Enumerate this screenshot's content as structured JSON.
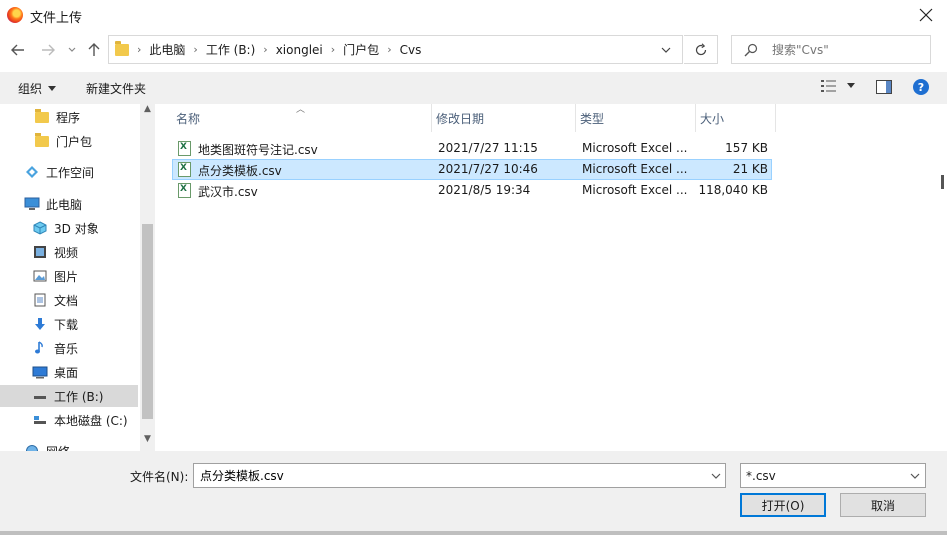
{
  "window": {
    "title": "文件上传"
  },
  "address": {
    "crumbs": [
      "此电脑",
      "工作 (B:)",
      "xionglei",
      "门户包",
      "Cvs"
    ]
  },
  "search": {
    "placeholder": "搜索\"Cvs\""
  },
  "toolbar": {
    "organize": "组织",
    "new_folder": "新建文件夹",
    "help": "?"
  },
  "nav": {
    "items": [
      {
        "label": "程序",
        "icon": "folder-icon"
      },
      {
        "label": "门户包",
        "icon": "folder-icon"
      },
      {
        "label": "工作空间",
        "icon": "workspace-icon"
      },
      {
        "label": "此电脑",
        "icon": "computer-icon"
      },
      {
        "label": "3D 对象",
        "icon": "3d-objects-icon"
      },
      {
        "label": "视频",
        "icon": "video-icon"
      },
      {
        "label": "图片",
        "icon": "pictures-icon"
      },
      {
        "label": "文档",
        "icon": "documents-icon"
      },
      {
        "label": "下载",
        "icon": "download-icon"
      },
      {
        "label": "音乐",
        "icon": "music-icon"
      },
      {
        "label": "桌面",
        "icon": "desktop-icon"
      },
      {
        "label": "工作 (B:)",
        "icon": "drive-icon"
      },
      {
        "label": "本地磁盘 (C:)",
        "icon": "drive-icon"
      },
      {
        "label": "网络",
        "icon": "network-icon"
      }
    ]
  },
  "columns": {
    "name": "名称",
    "modified": "修改日期",
    "type": "类型",
    "size": "大小"
  },
  "files": [
    {
      "name": "地类图斑符号注记.csv",
      "modified": "2021/7/27 11:15",
      "type": "Microsoft Excel ...",
      "size": "157 KB"
    },
    {
      "name": "点分类模板.csv",
      "modified": "2021/7/27 10:46",
      "type": "Microsoft Excel ...",
      "size": "21 KB"
    },
    {
      "name": "武汉市.csv",
      "modified": "2021/8/5 19:34",
      "type": "Microsoft Excel ...",
      "size": "118,040 KB"
    }
  ],
  "footer": {
    "filename_label": "文件名(N):",
    "filename_value": "点分类模板.csv",
    "filetype_value": "*.csv",
    "open_label": "打开(O)",
    "cancel_label": "取消"
  },
  "colors": {
    "accent": "#0078d7",
    "selection_bg": "#cce8ff",
    "folder": "#f2c94c"
  }
}
